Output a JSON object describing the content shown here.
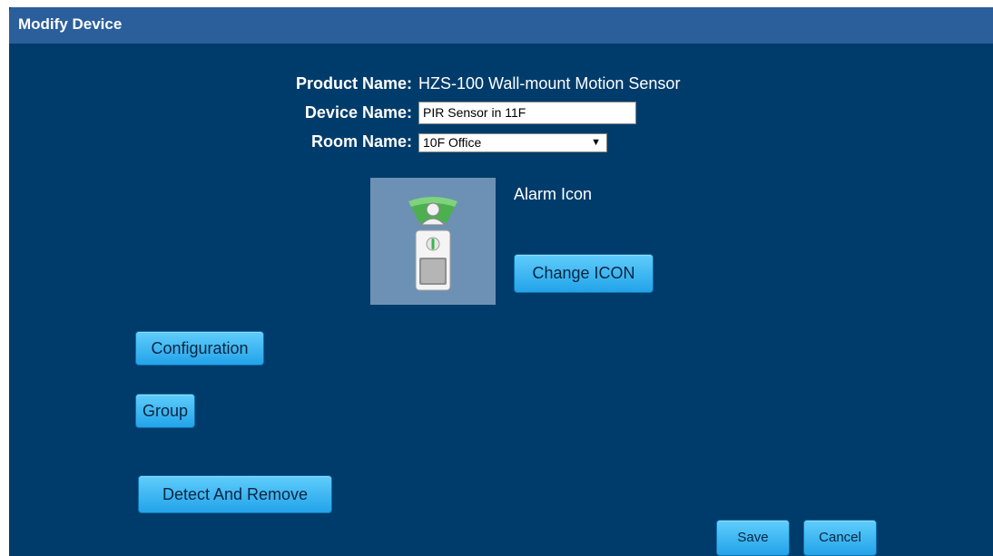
{
  "dialog": {
    "title": "Modify Device"
  },
  "form": {
    "product_name_label": "Product Name:",
    "product_name_value": "HZS-100 Wall-mount Motion Sensor",
    "device_name_label": "Device Name:",
    "device_name_value": "PIR Sensor in 11F",
    "room_name_label": "Room Name:",
    "room_name_value": "10F Office",
    "dropdown_arrow": "▼"
  },
  "icon_section": {
    "label": "Alarm Icon",
    "change_button": "Change ICON",
    "icon_name": "motion-sensor-icon"
  },
  "buttons": {
    "configuration": "Configuration",
    "group": "Group",
    "detect_remove": "Detect And Remove",
    "save": "Save",
    "cancel": "Cancel"
  },
  "colors": {
    "background": "#003c6b",
    "titlebar": "#2a5f9c",
    "button": "#23a3ea",
    "icon_tile": "#6d91b4"
  }
}
